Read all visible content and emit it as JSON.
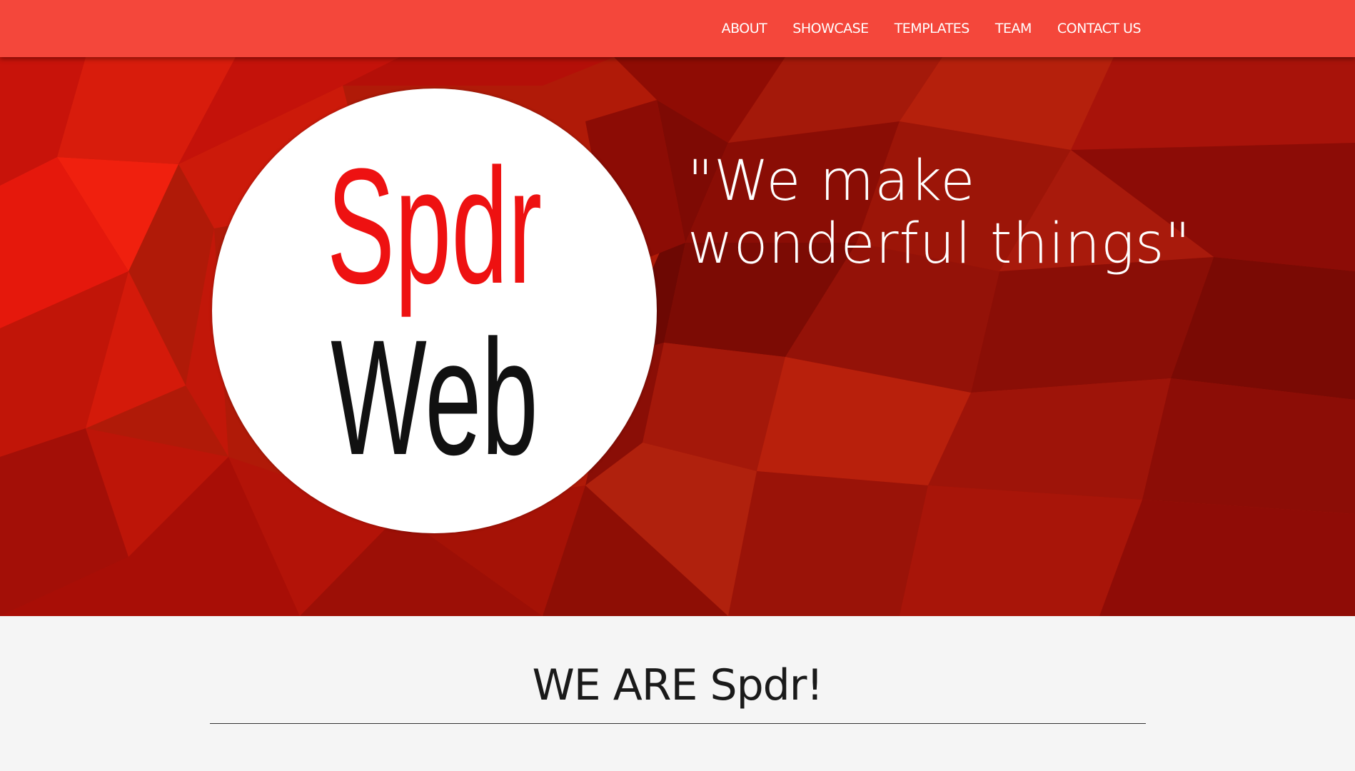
{
  "colors": {
    "navbar": "#f4473b",
    "hero_base": "#b01a08",
    "logo_red": "#ee1111",
    "logo_black": "#111111",
    "section_bg": "#f5f5f5"
  },
  "nav": {
    "items": [
      {
        "label": "ABOUT"
      },
      {
        "label": "SHOWCASE"
      },
      {
        "label": "TEMPLATES"
      },
      {
        "label": "TEAM"
      },
      {
        "label": "CONTACT US"
      }
    ]
  },
  "hero": {
    "logo": {
      "line1": "Spdr",
      "line2": "Web"
    },
    "tagline": {
      "line1": "\"We make",
      "line2": "wonderful things\""
    }
  },
  "about": {
    "title": "WE ARE Spdr!"
  }
}
